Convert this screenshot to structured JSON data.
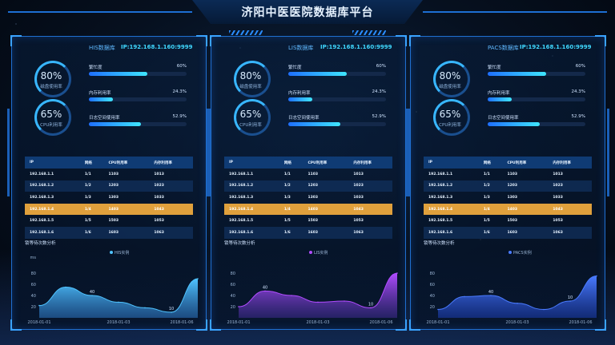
{
  "title": "济阳中医医院数据库平台",
  "colors": {
    "accent": "#1f6fd0",
    "highlight": "#e0a03c",
    "bar": "#3fe6ff"
  },
  "panels": [
    {
      "db_name": "HIS数据库",
      "ip": "IP:192.168.1.160:9999",
      "gauges": [
        {
          "value": "80%",
          "label": "磁盘使用率"
        },
        {
          "value": "65%",
          "label": "CPU利用率"
        }
      ],
      "metrics": [
        {
          "name": "繁忙度",
          "pct": "60%",
          "fill": 0.6
        },
        {
          "name": "内存利用率",
          "pct": "24.3%",
          "fill": 0.243
        },
        {
          "name": "日志空间使用率",
          "pct": "52.9%",
          "fill": 0.529
        }
      ],
      "table": {
        "headers": [
          "IP",
          "网络",
          "CPU利用率",
          "内存利用率"
        ],
        "rows": [
          [
            "192.168.1.1",
            "1/1",
            "1103",
            "1013"
          ],
          [
            "192.168.1.2",
            "1/2",
            "1203",
            "1023"
          ],
          [
            "192.168.1.3",
            "1/3",
            "1303",
            "1033"
          ],
          [
            "192.168.1.4",
            "1/4",
            "1403",
            "1043"
          ],
          [
            "192.168.1.5",
            "1/5",
            "1503",
            "1053"
          ],
          [
            "192.168.1.6",
            "1/6",
            "1603",
            "1063"
          ]
        ],
        "highlight_row": 3
      },
      "chart_title": "锁等待次数分析",
      "legend": "HIS实例"
    },
    {
      "db_name": "LIS数据库",
      "ip": "IP:192.168.1.160:9999",
      "gauges": [
        {
          "value": "80%",
          "label": "磁盘使用率"
        },
        {
          "value": "65%",
          "label": "CPU利用率"
        }
      ],
      "metrics": [
        {
          "name": "繁忙度",
          "pct": "60%",
          "fill": 0.6
        },
        {
          "name": "内存利用率",
          "pct": "24.3%",
          "fill": 0.243
        },
        {
          "name": "日志空间使用率",
          "pct": "52.9%",
          "fill": 0.529
        }
      ],
      "table": {
        "headers": [
          "IP",
          "网络",
          "CPU利用率",
          "内存利用率"
        ],
        "rows": [
          [
            "192.168.1.1",
            "1/1",
            "1103",
            "1013"
          ],
          [
            "192.168.1.2",
            "1/2",
            "1203",
            "1023"
          ],
          [
            "192.168.1.3",
            "1/3",
            "1303",
            "1033"
          ],
          [
            "192.168.1.4",
            "1/4",
            "1403",
            "1043"
          ],
          [
            "192.168.1.5",
            "1/5",
            "1503",
            "1053"
          ],
          [
            "192.168.1.6",
            "1/6",
            "1603",
            "1063"
          ]
        ],
        "highlight_row": 3
      },
      "chart_title": "锁等待次数分析",
      "legend": "LIS实例"
    },
    {
      "db_name": "PACS数据库",
      "ip": "IP:192.168.1.160:9999",
      "gauges": [
        {
          "value": "80%",
          "label": "磁盘使用率"
        },
        {
          "value": "65%",
          "label": "CPU利用率"
        }
      ],
      "metrics": [
        {
          "name": "繁忙度",
          "pct": "60%",
          "fill": 0.6
        },
        {
          "name": "内存利用率",
          "pct": "24.3%",
          "fill": 0.243
        },
        {
          "name": "日志空间使用率",
          "pct": "52.9%",
          "fill": 0.529
        }
      ],
      "table": {
        "headers": [
          "IP",
          "网络",
          "CPU利用率",
          "内存利用率"
        ],
        "rows": [
          [
            "192.168.1.1",
            "1/1",
            "1103",
            "1013"
          ],
          [
            "192.168.1.2",
            "1/2",
            "1203",
            "1023"
          ],
          [
            "192.168.1.3",
            "1/3",
            "1303",
            "1033"
          ],
          [
            "192.168.1.4",
            "1/4",
            "1403",
            "1043"
          ],
          [
            "192.168.1.5",
            "1/5",
            "1503",
            "1053"
          ],
          [
            "192.168.1.6",
            "1/6",
            "1603",
            "1063"
          ]
        ],
        "highlight_row": 3
      },
      "chart_title": "锁等待次数分析",
      "legend": "PACS实例"
    }
  ],
  "chart_data": [
    {
      "type": "area",
      "title": "锁等待次数分析",
      "ylabel": "ms",
      "ylim": [
        0,
        100
      ],
      "yticks": [
        20,
        40,
        60,
        80
      ],
      "x_ticks": [
        "2018-01-01",
        "2018-01-03",
        "2018-01-06"
      ],
      "x": [
        0,
        1,
        2,
        3,
        4,
        5,
        6
      ],
      "values": [
        22,
        55,
        40,
        28,
        18,
        10,
        70
      ],
      "labels": [
        {
          "x": 2,
          "text": "40"
        },
        {
          "x": 5,
          "text": "10"
        }
      ],
      "series": [
        {
          "name": "HIS实例"
        }
      ]
    },
    {
      "type": "area",
      "title": "锁等待次数分析",
      "ylim": [
        0,
        100
      ],
      "yticks": [
        20,
        40,
        60,
        80
      ],
      "x_ticks": [
        "2018-01-01",
        "2018-01-03",
        "2018-01-06"
      ],
      "x": [
        0,
        1,
        2,
        3,
        4,
        5,
        6
      ],
      "values": [
        20,
        48,
        40,
        28,
        30,
        18,
        80
      ],
      "labels": [
        {
          "x": 1,
          "text": "40"
        },
        {
          "x": 5,
          "text": "10"
        }
      ],
      "series": [
        {
          "name": "LIS实例"
        }
      ]
    },
    {
      "type": "area",
      "title": "锁等待次数分析",
      "ylim": [
        0,
        100
      ],
      "yticks": [
        20,
        40,
        60,
        80
      ],
      "x_ticks": [
        "2018-01-01",
        "2018-01-03",
        "2018-01-06"
      ],
      "x": [
        0,
        1,
        2,
        3,
        4,
        5,
        6
      ],
      "values": [
        15,
        38,
        40,
        26,
        15,
        30,
        75
      ],
      "labels": [
        {
          "x": 2,
          "text": "40"
        },
        {
          "x": 5,
          "text": "10"
        }
      ],
      "series": [
        {
          "name": "PACS实例"
        }
      ]
    }
  ]
}
